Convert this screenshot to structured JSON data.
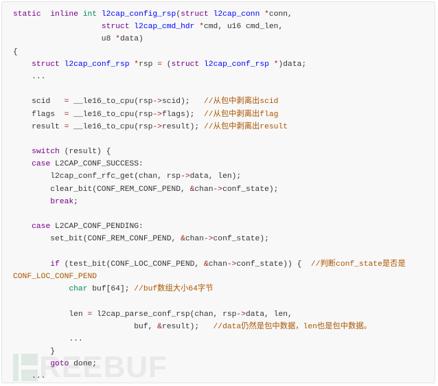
{
  "code_block": {
    "language": "c",
    "lines": [
      [
        [
          "kw",
          "static"
        ],
        [
          "",
          "  "
        ],
        [
          "kw",
          "inline"
        ],
        [
          "",
          " "
        ],
        [
          "ty",
          "int"
        ],
        [
          "",
          " "
        ],
        [
          "fn",
          "l2cap_config_rsp"
        ],
        [
          "",
          "("
        ],
        [
          "kw",
          "struct"
        ],
        [
          "",
          " "
        ],
        [
          "fn",
          "l2cap_conn"
        ],
        [
          "",
          " "
        ],
        [
          "op",
          "*"
        ],
        [
          "",
          "conn,"
        ]
      ],
      [
        [
          "",
          "                   "
        ],
        [
          "kw",
          "struct"
        ],
        [
          "",
          " "
        ],
        [
          "fn",
          "l2cap_cmd_hdr"
        ],
        [
          "",
          " "
        ],
        [
          "op",
          "*"
        ],
        [
          "",
          "cmd, u16 cmd_len,"
        ]
      ],
      [
        [
          "",
          "                   u8 "
        ],
        [
          "op",
          "*"
        ],
        [
          "",
          "data)"
        ]
      ],
      [
        [
          "",
          "{"
        ]
      ],
      [
        [
          "",
          "    "
        ],
        [
          "kw",
          "struct"
        ],
        [
          "",
          " "
        ],
        [
          "fn",
          "l2cap_conf_rsp"
        ],
        [
          "",
          " "
        ],
        [
          "op",
          "*"
        ],
        [
          "",
          "rsp "
        ],
        [
          "op",
          "="
        ],
        [
          "",
          " ("
        ],
        [
          "kw",
          "struct"
        ],
        [
          "",
          " "
        ],
        [
          "fn",
          "l2cap_conf_rsp"
        ],
        [
          "",
          " "
        ],
        [
          "op",
          "*"
        ],
        [
          "",
          ")data;"
        ]
      ],
      [
        [
          "",
          "    ..."
        ]
      ],
      [
        [
          "",
          ""
        ]
      ],
      [
        [
          "",
          "    scid   "
        ],
        [
          "op",
          "="
        ],
        [
          "",
          "",
          " __le16_to_cpu(rsp"
        ],
        [
          "op",
          "->"
        ],
        [
          "",
          "scid);   "
        ],
        [
          "cm",
          "//从包中剥离出scid"
        ]
      ],
      [
        [
          "",
          "    flags  "
        ],
        [
          "op",
          "="
        ],
        [
          "",
          " __le16_to_cpu(rsp"
        ],
        [
          "op",
          "->"
        ],
        [
          "",
          "flags);  "
        ],
        [
          "cm",
          "//从包中剥离出flag"
        ]
      ],
      [
        [
          "",
          "    result "
        ],
        [
          "op",
          "="
        ],
        [
          "",
          " __le16_to_cpu(rsp"
        ],
        [
          "op",
          "->"
        ],
        [
          "",
          "result); "
        ],
        [
          "cm",
          "//从包中剥离出result"
        ]
      ],
      [
        [
          "",
          ""
        ]
      ],
      [
        [
          "",
          "    "
        ],
        [
          "kw",
          "switch"
        ],
        [
          "",
          " (result) {"
        ]
      ],
      [
        [
          "",
          "    "
        ],
        [
          "kw",
          "case"
        ],
        [
          "",
          " L2CAP_CONF_SUCCESS:"
        ]
      ],
      [
        [
          "",
          "        l2cap_conf_rfc_get(chan, rsp"
        ],
        [
          "op",
          "->"
        ],
        [
          "",
          "data, len);"
        ]
      ],
      [
        [
          "",
          "        clear_bit(CONF_REM_CONF_PEND, "
        ],
        [
          "op",
          "&"
        ],
        [
          "",
          "chan"
        ],
        [
          "op",
          "->"
        ],
        [
          "",
          "conf_state);"
        ]
      ],
      [
        [
          "",
          "        "
        ],
        [
          "kw",
          "break"
        ],
        [
          "",
          ";"
        ]
      ],
      [
        [
          "",
          ""
        ]
      ],
      [
        [
          "",
          "    "
        ],
        [
          "kw",
          "case"
        ],
        [
          "",
          " L2CAP_CONF_PENDING:"
        ]
      ],
      [
        [
          "",
          "        set_bit(CONF_REM_CONF_PEND, "
        ],
        [
          "op",
          "&"
        ],
        [
          "",
          "chan"
        ],
        [
          "op",
          "->"
        ],
        [
          "",
          "conf_state);"
        ]
      ],
      [
        [
          "",
          ""
        ]
      ],
      [
        [
          "",
          "        "
        ],
        [
          "kw",
          "if"
        ],
        [
          "",
          " (test_bit(CONF_LOC_CONF_PEND, "
        ],
        [
          "op",
          "&"
        ],
        [
          "",
          "chan"
        ],
        [
          "op",
          "->"
        ],
        [
          "",
          "conf_state)) {  "
        ],
        [
          "cm",
          "//判断conf_state是否是"
        ]
      ],
      [
        [
          "cm",
          "CONF_LOC_CONF_PEND"
        ]
      ],
      [
        [
          "",
          "            "
        ],
        [
          "ty",
          "char"
        ],
        [
          "",
          " buf[64]; "
        ],
        [
          "cm",
          "//buf数组大小64字节"
        ]
      ],
      [
        [
          "",
          ""
        ]
      ],
      [
        [
          "",
          "            len "
        ],
        [
          "op",
          "="
        ],
        [
          "",
          " l2cap_parse_conf_rsp(chan, rsp"
        ],
        [
          "op",
          "->"
        ],
        [
          "",
          "data, len,"
        ]
      ],
      [
        [
          "",
          "                          buf, "
        ],
        [
          "op",
          "&"
        ],
        [
          "",
          "result);   "
        ],
        [
          "cm",
          "//data仍然是包中数据，len也是包中数据。"
        ]
      ],
      [
        [
          "",
          "            ..."
        ]
      ],
      [
        [
          "",
          "        }"
        ]
      ],
      [
        [
          "",
          "        "
        ],
        [
          "kw",
          "goto"
        ],
        [
          "",
          " done;"
        ]
      ],
      [
        [
          "",
          "    ..."
        ]
      ]
    ]
  },
  "watermark": {
    "text": "REEBUF"
  },
  "colors": {
    "background": "#f8f8f8",
    "keyword": "#770088",
    "type": "#008855",
    "identifier": "#0000ff",
    "operator": "#981a1a",
    "comment": "#aa5500",
    "text": "#333333"
  }
}
